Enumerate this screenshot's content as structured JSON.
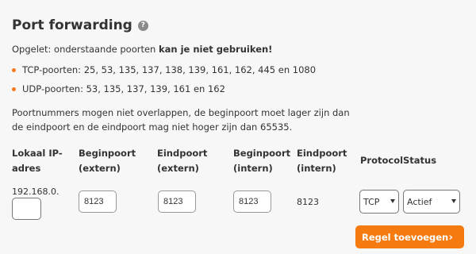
{
  "title": "Port forwarding",
  "help_icon": "?",
  "warning": {
    "prefix": "Opgelet: onderstaande poorten ",
    "bold": "kan je niet gebruiken!"
  },
  "bullets": [
    "TCP-poorten: 25, 53, 135, 137, 138, 139, 161, 162, 445 en 1080",
    "UDP-poorten: 53, 135, 137, 139, 161 en 162"
  ],
  "note": "Poortnummers mogen niet overlappen, de beginpoort moet lager zijn dan de eindpoort en de eindpoort mag niet hoger zijn dan 65535.",
  "headers": {
    "local_ip": "Lokaal IP-adres",
    "begin_ext": "Beginpoort (extern)",
    "end_ext": "Eindpoort (extern)",
    "begin_int": "Beginpoort (intern)",
    "end_int": "Eindpoort (intern)",
    "protocol": "Protocol",
    "status": "Status"
  },
  "row": {
    "ip_prefix": "192.168.0.",
    "ip_last": "",
    "begin_ext": "8123",
    "end_ext": "8123",
    "begin_int": "8123",
    "end_int": "8123",
    "protocol": "TCP",
    "status": "Actief"
  },
  "add_button": "Regel toevoegen",
  "add_arrow": "›",
  "colors": {
    "accent": "#f57a10",
    "bullet": "#f57a1f"
  }
}
